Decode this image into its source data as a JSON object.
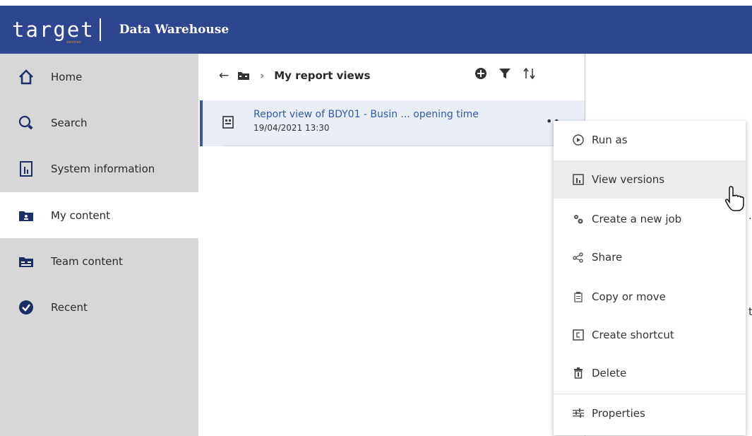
{
  "header": {
    "logo_text": "target",
    "logo_sub": "services",
    "app_title": "Data Warehouse"
  },
  "sidebar": {
    "items": [
      {
        "label": "Home",
        "icon": "home-icon"
      },
      {
        "label": "Search",
        "icon": "search-icon"
      },
      {
        "label": "System information",
        "icon": "system-info-icon"
      },
      {
        "label": "My content",
        "icon": "my-content-folder-icon"
      },
      {
        "label": "Team content",
        "icon": "team-content-folder-icon"
      },
      {
        "label": "Recent",
        "icon": "recent-check-icon"
      }
    ]
  },
  "content": {
    "breadcrumb": {
      "back_icon": "arrow-left-icon",
      "folder_icon": "folder-icon",
      "separator": "›",
      "title": "My report views"
    },
    "toolbar_icons": [
      "add-icon",
      "filter-icon",
      "sort-icon"
    ],
    "rows": [
      {
        "title": "Report view of BDY01 - Busin ... opening time",
        "date": "19/04/2021 13:30",
        "more": "••"
      }
    ]
  },
  "context_menu": {
    "items": [
      {
        "label": "Run as",
        "icon": "run-as-icon"
      },
      {
        "label": "View versions",
        "icon": "versions-icon"
      },
      {
        "label": "Create a new job",
        "icon": "gears-icon"
      },
      {
        "label": "Share",
        "icon": "share-icon"
      },
      {
        "label": "Copy or move",
        "icon": "copy-icon"
      },
      {
        "label": "Create shortcut",
        "icon": "shortcut-icon"
      },
      {
        "label": "Delete",
        "icon": "trash-icon"
      },
      {
        "label": "Properties",
        "icon": "properties-icon"
      }
    ]
  },
  "clipped_chars": [
    ".",
    "t"
  ],
  "colors": {
    "header": "#2e4690",
    "accent": "#3a5b9c",
    "link": "#3459a6",
    "logo_sub": "#e3872e"
  }
}
